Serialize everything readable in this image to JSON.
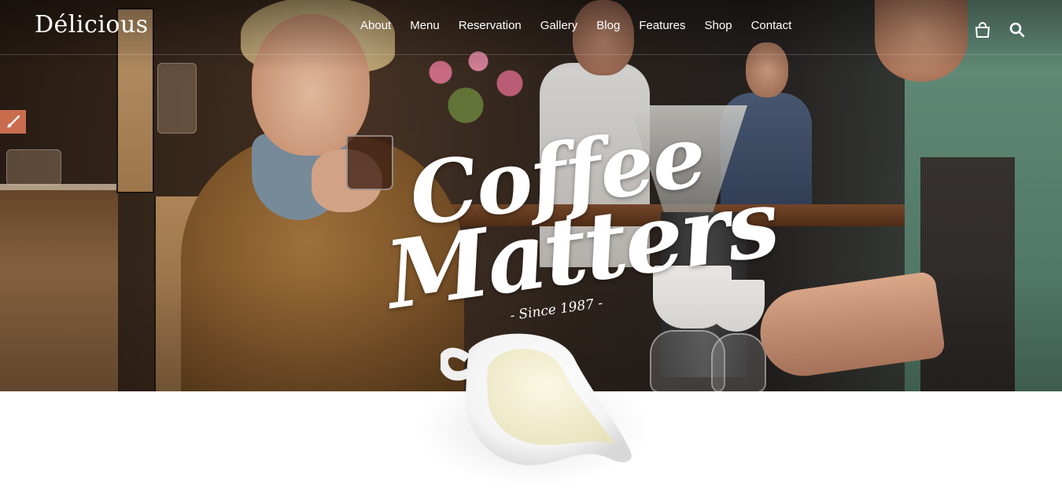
{
  "brand": {
    "logo": "Délicious"
  },
  "nav": {
    "items": [
      {
        "label": "About"
      },
      {
        "label": "Menu"
      },
      {
        "label": "Reservation"
      },
      {
        "label": "Gallery"
      },
      {
        "label": "Blog"
      },
      {
        "label": "Features"
      },
      {
        "label": "Shop"
      },
      {
        "label": "Contact"
      }
    ]
  },
  "header_icons": {
    "cart": "shopping-bag-icon",
    "search": "search-icon"
  },
  "side_tab": {
    "icon": "paintbrush-icon",
    "color": "#c96c4e"
  },
  "hero": {
    "headline_line1": "Coffee",
    "headline_line2": "Matters",
    "tagline": "- Since 1987 -"
  },
  "colors": {
    "accent": "#c96c4e",
    "text_light": "#ffffff",
    "page_bg": "#ffffff"
  }
}
